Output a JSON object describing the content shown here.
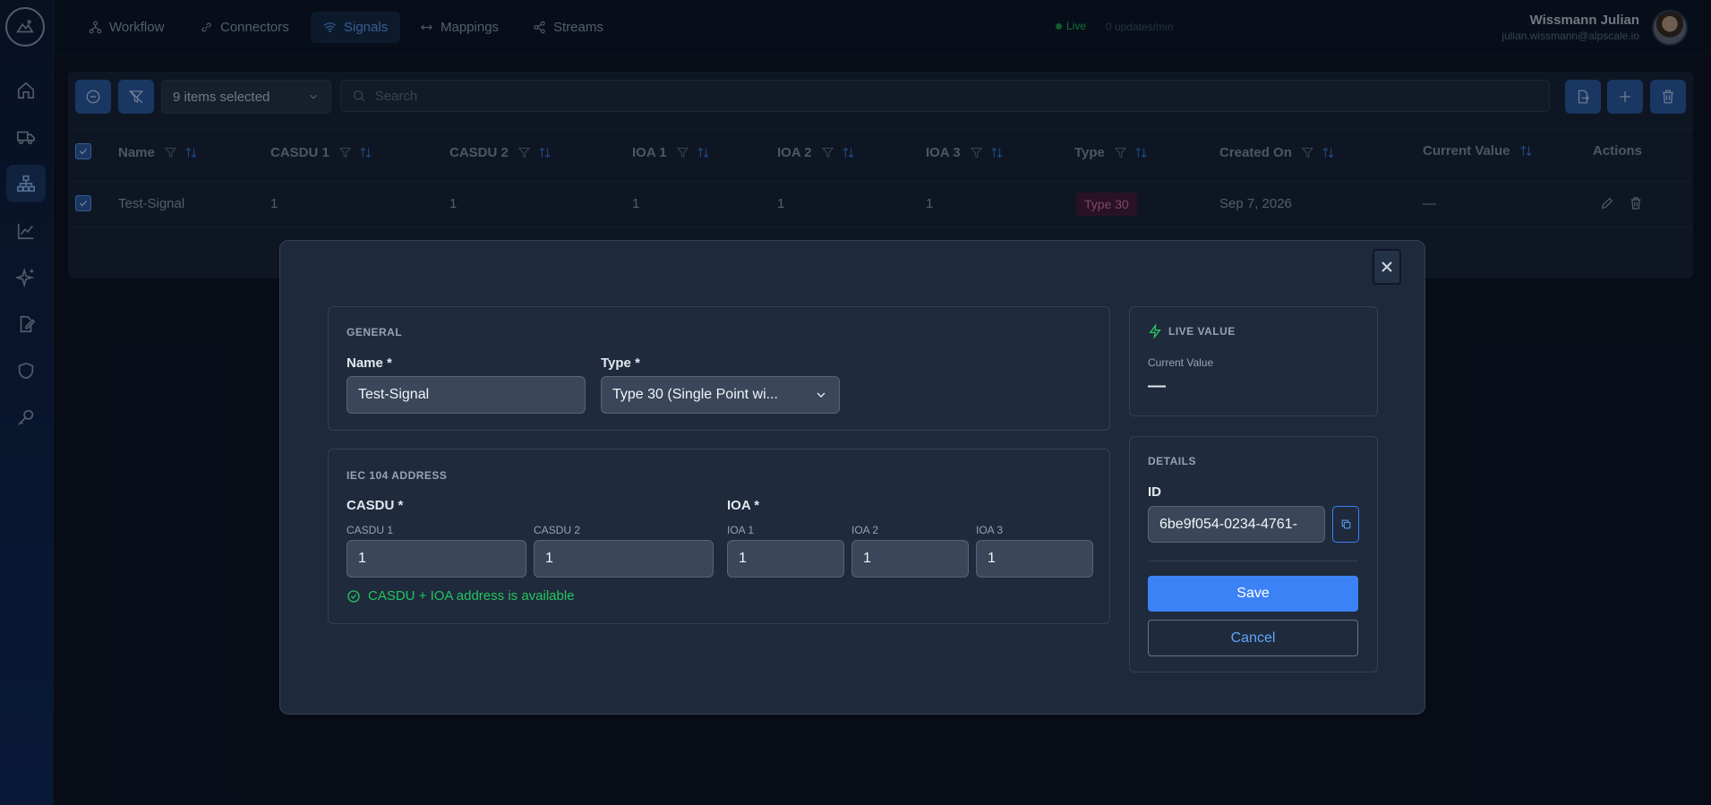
{
  "nav": {
    "tabs": [
      {
        "label": "Workflow",
        "icon": "workflow-icon"
      },
      {
        "label": "Connectors",
        "icon": "link-icon"
      },
      {
        "label": "Signals",
        "icon": "wifi-icon"
      },
      {
        "label": "Mappings",
        "icon": "arrows-icon"
      },
      {
        "label": "Streams",
        "icon": "share-icon"
      }
    ],
    "live_label": "Live",
    "updates_label": "0 updates/min"
  },
  "user": {
    "name": "Wissmann Julian",
    "email": "julian.wissmann@alpscale.io"
  },
  "toolbar": {
    "selection_label": "9 items selected",
    "search_placeholder": "Search"
  },
  "table": {
    "headers": [
      "Name",
      "CASDU 1",
      "CASDU 2",
      "IOA 1",
      "IOA 2",
      "IOA 3",
      "Type",
      "Created On",
      "Current Value",
      "Actions"
    ],
    "row": {
      "name": "Test-Signal",
      "casdu1": "1",
      "casdu2": "1",
      "ioa1": "1",
      "ioa2": "1",
      "ioa3": "1",
      "type": "Type 30",
      "created_on": "Sep 7, 2026",
      "current_value": "—"
    }
  },
  "modal": {
    "general": {
      "section": "GENERAL",
      "name_label": "Name *",
      "name_value": "Test-Signal",
      "type_label": "Type *",
      "type_value": "Type 30 (Single Point wi..."
    },
    "address": {
      "section": "IEC 104 ADDRESS",
      "casdu_label": "CASDU *",
      "casdu1_label": "CASDU 1",
      "casdu1_value": "1",
      "casdu2_label": "CASDU 2",
      "casdu2_value": "1",
      "ioa_label": "IOA *",
      "ioa1_label": "IOA 1",
      "ioa1_value": "1",
      "ioa2_label": "IOA 2",
      "ioa2_value": "1",
      "ioa3_label": "IOA 3",
      "ioa3_value": "1",
      "validation": "CASDU + IOA address is available"
    },
    "live": {
      "section": "LIVE VALUE",
      "current_label": "Current Value",
      "current_value": "—"
    },
    "details": {
      "section": "DETAILS",
      "id_label": "ID",
      "id_value": "6be9f054-0234-4761-",
      "save_label": "Save",
      "cancel_label": "Cancel"
    }
  },
  "colors": {
    "accent": "#3b82f6",
    "success": "#22c55e",
    "badge": "#e879a9"
  }
}
